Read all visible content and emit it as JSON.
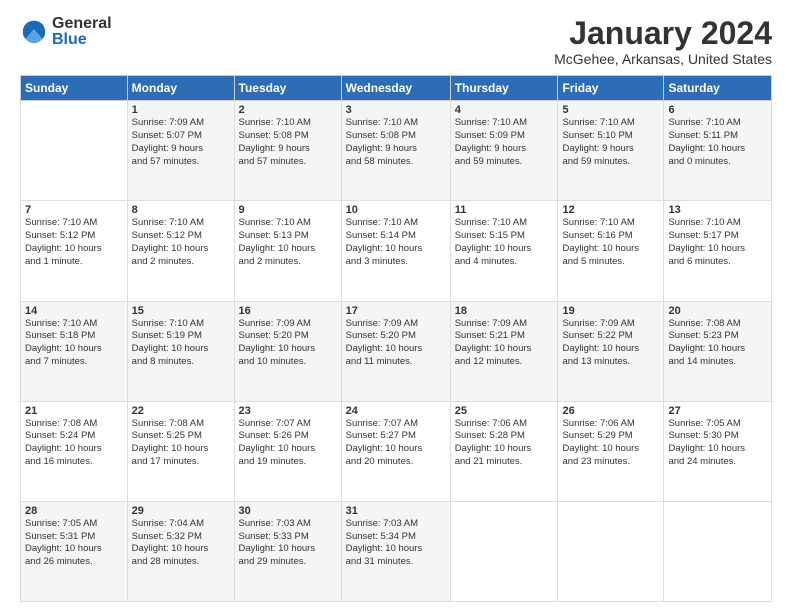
{
  "logo": {
    "general": "General",
    "blue": "Blue"
  },
  "title": "January 2024",
  "location": "McGehee, Arkansas, United States",
  "days_of_week": [
    "Sunday",
    "Monday",
    "Tuesday",
    "Wednesday",
    "Thursday",
    "Friday",
    "Saturday"
  ],
  "weeks": [
    [
      {
        "num": "",
        "info": ""
      },
      {
        "num": "1",
        "info": "Sunrise: 7:09 AM\nSunset: 5:07 PM\nDaylight: 9 hours\nand 57 minutes."
      },
      {
        "num": "2",
        "info": "Sunrise: 7:10 AM\nSunset: 5:08 PM\nDaylight: 9 hours\nand 57 minutes."
      },
      {
        "num": "3",
        "info": "Sunrise: 7:10 AM\nSunset: 5:08 PM\nDaylight: 9 hours\nand 58 minutes."
      },
      {
        "num": "4",
        "info": "Sunrise: 7:10 AM\nSunset: 5:09 PM\nDaylight: 9 hours\nand 59 minutes."
      },
      {
        "num": "5",
        "info": "Sunrise: 7:10 AM\nSunset: 5:10 PM\nDaylight: 9 hours\nand 59 minutes."
      },
      {
        "num": "6",
        "info": "Sunrise: 7:10 AM\nSunset: 5:11 PM\nDaylight: 10 hours\nand 0 minutes."
      }
    ],
    [
      {
        "num": "7",
        "info": "Sunrise: 7:10 AM\nSunset: 5:12 PM\nDaylight: 10 hours\nand 1 minute."
      },
      {
        "num": "8",
        "info": "Sunrise: 7:10 AM\nSunset: 5:12 PM\nDaylight: 10 hours\nand 2 minutes."
      },
      {
        "num": "9",
        "info": "Sunrise: 7:10 AM\nSunset: 5:13 PM\nDaylight: 10 hours\nand 2 minutes."
      },
      {
        "num": "10",
        "info": "Sunrise: 7:10 AM\nSunset: 5:14 PM\nDaylight: 10 hours\nand 3 minutes."
      },
      {
        "num": "11",
        "info": "Sunrise: 7:10 AM\nSunset: 5:15 PM\nDaylight: 10 hours\nand 4 minutes."
      },
      {
        "num": "12",
        "info": "Sunrise: 7:10 AM\nSunset: 5:16 PM\nDaylight: 10 hours\nand 5 minutes."
      },
      {
        "num": "13",
        "info": "Sunrise: 7:10 AM\nSunset: 5:17 PM\nDaylight: 10 hours\nand 6 minutes."
      }
    ],
    [
      {
        "num": "14",
        "info": "Sunrise: 7:10 AM\nSunset: 5:18 PM\nDaylight: 10 hours\nand 7 minutes."
      },
      {
        "num": "15",
        "info": "Sunrise: 7:10 AM\nSunset: 5:19 PM\nDaylight: 10 hours\nand 8 minutes."
      },
      {
        "num": "16",
        "info": "Sunrise: 7:09 AM\nSunset: 5:20 PM\nDaylight: 10 hours\nand 10 minutes."
      },
      {
        "num": "17",
        "info": "Sunrise: 7:09 AM\nSunset: 5:20 PM\nDaylight: 10 hours\nand 11 minutes."
      },
      {
        "num": "18",
        "info": "Sunrise: 7:09 AM\nSunset: 5:21 PM\nDaylight: 10 hours\nand 12 minutes."
      },
      {
        "num": "19",
        "info": "Sunrise: 7:09 AM\nSunset: 5:22 PM\nDaylight: 10 hours\nand 13 minutes."
      },
      {
        "num": "20",
        "info": "Sunrise: 7:08 AM\nSunset: 5:23 PM\nDaylight: 10 hours\nand 14 minutes."
      }
    ],
    [
      {
        "num": "21",
        "info": "Sunrise: 7:08 AM\nSunset: 5:24 PM\nDaylight: 10 hours\nand 16 minutes."
      },
      {
        "num": "22",
        "info": "Sunrise: 7:08 AM\nSunset: 5:25 PM\nDaylight: 10 hours\nand 17 minutes."
      },
      {
        "num": "23",
        "info": "Sunrise: 7:07 AM\nSunset: 5:26 PM\nDaylight: 10 hours\nand 19 minutes."
      },
      {
        "num": "24",
        "info": "Sunrise: 7:07 AM\nSunset: 5:27 PM\nDaylight: 10 hours\nand 20 minutes."
      },
      {
        "num": "25",
        "info": "Sunrise: 7:06 AM\nSunset: 5:28 PM\nDaylight: 10 hours\nand 21 minutes."
      },
      {
        "num": "26",
        "info": "Sunrise: 7:06 AM\nSunset: 5:29 PM\nDaylight: 10 hours\nand 23 minutes."
      },
      {
        "num": "27",
        "info": "Sunrise: 7:05 AM\nSunset: 5:30 PM\nDaylight: 10 hours\nand 24 minutes."
      }
    ],
    [
      {
        "num": "28",
        "info": "Sunrise: 7:05 AM\nSunset: 5:31 PM\nDaylight: 10 hours\nand 26 minutes."
      },
      {
        "num": "29",
        "info": "Sunrise: 7:04 AM\nSunset: 5:32 PM\nDaylight: 10 hours\nand 28 minutes."
      },
      {
        "num": "30",
        "info": "Sunrise: 7:03 AM\nSunset: 5:33 PM\nDaylight: 10 hours\nand 29 minutes."
      },
      {
        "num": "31",
        "info": "Sunrise: 7:03 AM\nSunset: 5:34 PM\nDaylight: 10 hours\nand 31 minutes."
      },
      {
        "num": "",
        "info": ""
      },
      {
        "num": "",
        "info": ""
      },
      {
        "num": "",
        "info": ""
      }
    ]
  ]
}
